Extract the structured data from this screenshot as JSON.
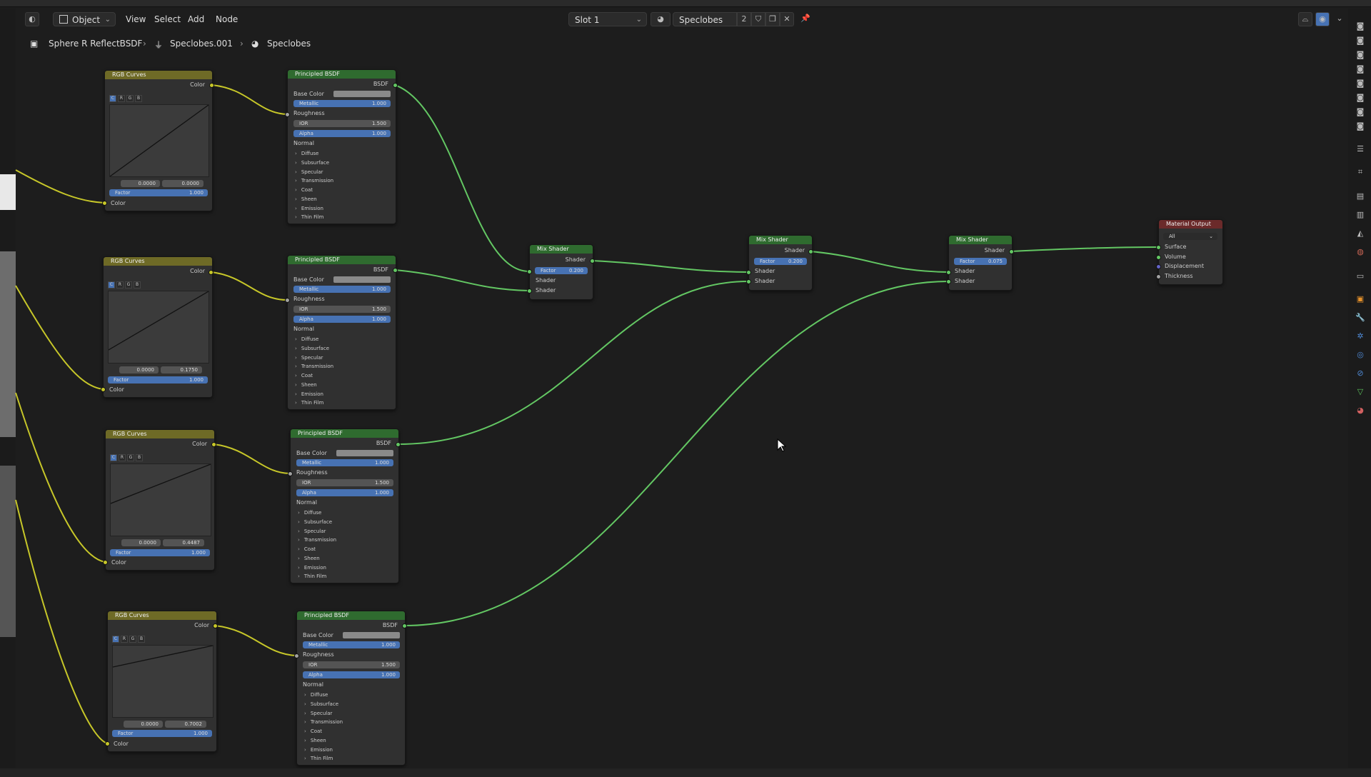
{
  "header": {
    "mode_label": "Object",
    "menu": [
      "View",
      "Select",
      "Add",
      "Node"
    ],
    "slot_label": "Slot 1",
    "material_name": "Speclobes",
    "user_count": "2"
  },
  "breadcrumb": {
    "object": "Sphere R ReflectBSDF",
    "mesh": "Speclobes.001",
    "material": "Speclobes"
  },
  "curves_nodes": [
    {
      "title": "RGB Curves",
      "out_label": "Color",
      "channels": [
        "C",
        "R",
        "G",
        "B"
      ],
      "x_val": "0.0000",
      "y_val": "0.0000",
      "factor_label": "Factor",
      "factor": "1.000",
      "in_label": "Color"
    },
    {
      "title": "RGB Curves",
      "out_label": "Color",
      "channels": [
        "C",
        "R",
        "G",
        "B"
      ],
      "x_val": "0.0000",
      "y_val": "0.1750",
      "factor_label": "Factor",
      "factor": "1.000",
      "in_label": "Color"
    },
    {
      "title": "RGB Curves",
      "out_label": "Color",
      "channels": [
        "C",
        "R",
        "G",
        "B"
      ],
      "x_val": "0.0000",
      "y_val": "0.4487",
      "factor_label": "Factor",
      "factor": "1.000",
      "in_label": "Color"
    },
    {
      "title": "RGB Curves",
      "out_label": "Color",
      "channels": [
        "C",
        "R",
        "G",
        "B"
      ],
      "x_val": "0.0000",
      "y_val": "0.7002",
      "factor_label": "Factor",
      "factor": "1.000",
      "in_label": "Color"
    }
  ],
  "bsdf_nodes": [
    {
      "title": "Principled BSDF",
      "out_label": "BSDF",
      "base_color": "Base Color",
      "metallic_label": "Metallic",
      "metallic": "1.000",
      "roughness": "Roughness",
      "ior_label": "IOR",
      "ior": "1.500",
      "alpha_label": "Alpha",
      "alpha": "1.000",
      "normal": "Normal",
      "panels": [
        "Diffuse",
        "Subsurface",
        "Specular",
        "Transmission",
        "Coat",
        "Sheen",
        "Emission",
        "Thin Film"
      ]
    },
    {
      "title": "Principled BSDF",
      "out_label": "BSDF",
      "base_color": "Base Color",
      "metallic_label": "Metallic",
      "metallic": "1.000",
      "roughness": "Roughness",
      "ior_label": "IOR",
      "ior": "1.500",
      "alpha_label": "Alpha",
      "alpha": "1.000",
      "normal": "Normal",
      "panels": [
        "Diffuse",
        "Subsurface",
        "Specular",
        "Transmission",
        "Coat",
        "Sheen",
        "Emission",
        "Thin Film"
      ]
    },
    {
      "title": "Principled BSDF",
      "out_label": "BSDF",
      "base_color": "Base Color",
      "metallic_label": "Metallic",
      "metallic": "1.000",
      "roughness": "Roughness",
      "ior_label": "IOR",
      "ior": "1.500",
      "alpha_label": "Alpha",
      "alpha": "1.000",
      "normal": "Normal",
      "panels": [
        "Diffuse",
        "Subsurface",
        "Specular",
        "Transmission",
        "Coat",
        "Sheen",
        "Emission",
        "Thin Film"
      ]
    },
    {
      "title": "Principled BSDF",
      "out_label": "BSDF",
      "base_color": "Base Color",
      "metallic_label": "Metallic",
      "metallic": "1.000",
      "roughness": "Roughness",
      "ior_label": "IOR",
      "ior": "1.500",
      "alpha_label": "Alpha",
      "alpha": "1.000",
      "normal": "Normal",
      "panels": [
        "Diffuse",
        "Subsurface",
        "Specular",
        "Transmission",
        "Coat",
        "Sheen",
        "Emission",
        "Thin Film"
      ]
    }
  ],
  "mix_nodes": [
    {
      "title": "Mix Shader",
      "out_label": "Shader",
      "factor_label": "Factor",
      "factor": "0.200",
      "in1": "Shader",
      "in2": "Shader"
    },
    {
      "title": "Mix Shader",
      "out_label": "Shader",
      "factor_label": "Factor",
      "factor": "0.200",
      "in1": "Shader",
      "in2": "Shader"
    },
    {
      "title": "Mix Shader",
      "out_label": "Shader",
      "factor_label": "Factor",
      "factor": "0.075",
      "in1": "Shader",
      "in2": "Shader"
    }
  ],
  "output_node": {
    "title": "Material Output",
    "target": "All",
    "inputs": [
      "Surface",
      "Volume",
      "Displacement",
      "Thickness"
    ]
  },
  "colors": {
    "curves_header": "#6e6a26",
    "shader_header": "#2f6b2f",
    "output_header": "#6b2a2a",
    "wire_color": "#c7c729",
    "wire_shader": "#63c763",
    "field_active": "#4772b3"
  }
}
